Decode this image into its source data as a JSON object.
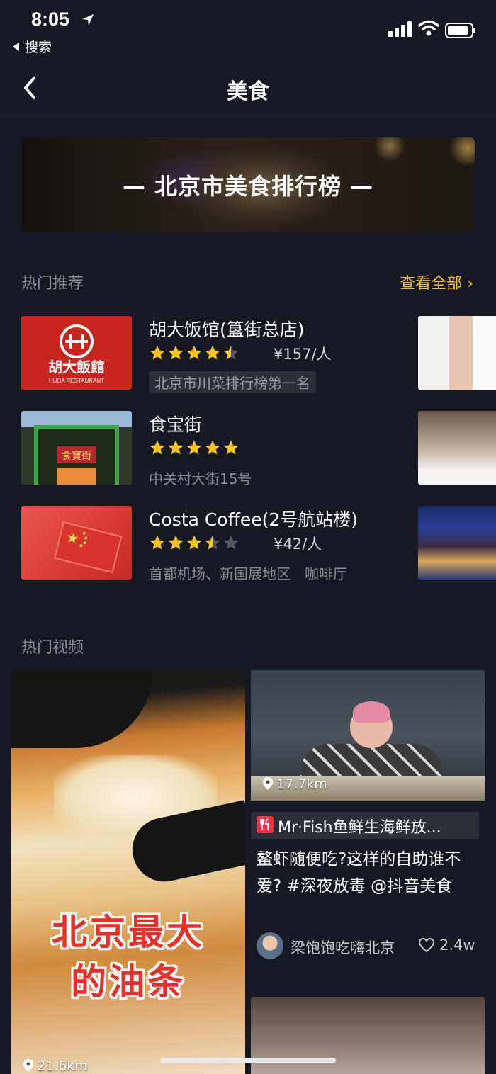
{
  "status_bar": {
    "time": "8:05",
    "back_app": "搜索"
  },
  "nav": {
    "title": "美食"
  },
  "banner": {
    "text": "— 北京市美食排行榜 —"
  },
  "hot_recommend": {
    "title": "热门推荐",
    "see_all": "查看全部",
    "items": [
      {
        "name": "胡大饭馆(簋街总店)",
        "rating": 4.5,
        "price": "¥157/人",
        "tag": "北京市川菜排行榜第一名",
        "thumb_text": "胡大飯館",
        "thumb_sub": "HUDA RESTAURANT"
      },
      {
        "name": "食宝街",
        "rating": 5,
        "price": "",
        "addr": "中关村大街15号",
        "thumb_text": "食寶街"
      },
      {
        "name": "Costa Coffee(2号航站楼)",
        "rating": 3.5,
        "price": "¥42/人",
        "addr": "首都机场、新国展地区　咖啡厅"
      }
    ]
  },
  "hot_videos": {
    "title": "热门视频",
    "left": {
      "overlay": [
        "北京最大",
        "的油条"
      ],
      "distance": "21.6km"
    },
    "right": {
      "distance": "17.7km",
      "title": "Mr·Fish鱼鲜生海鲜放...",
      "desc": "鳌虾随便吃?这样的自助谁不爱? #深夜放毒 @抖音美食",
      "author": "梁饱饱吃嗨北京",
      "likes": "2.4w"
    }
  },
  "colors": {
    "background": "#161823",
    "accent": "#f2c02a",
    "star": "#f5c518",
    "secondary_text": "#8a8b91"
  }
}
